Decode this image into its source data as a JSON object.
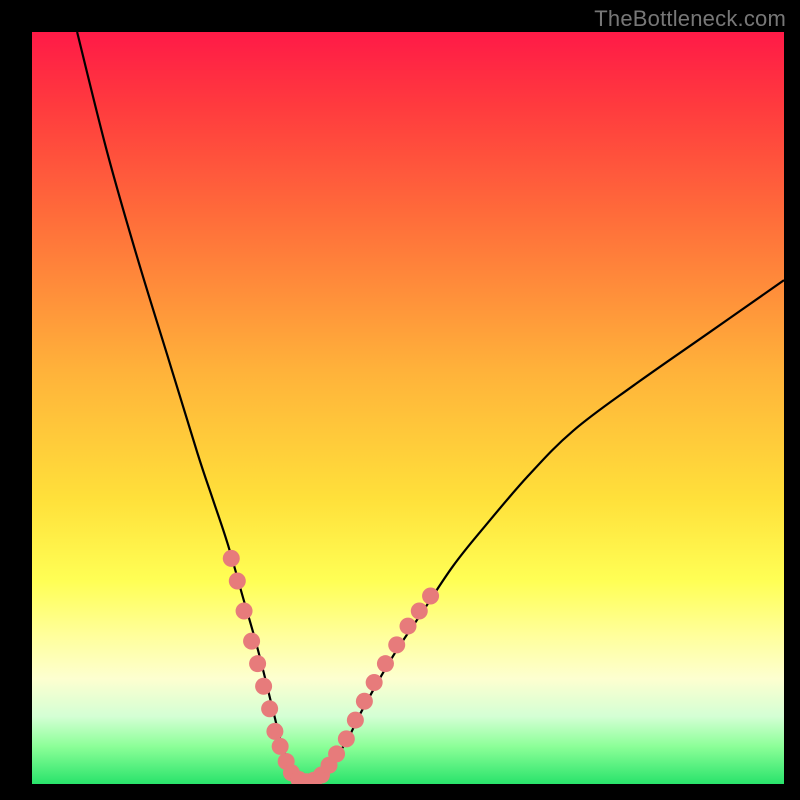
{
  "watermark": "TheBottleneck.com",
  "chart_data": {
    "type": "line",
    "title": "",
    "xlabel": "",
    "ylabel": "",
    "xlim": [
      0,
      100
    ],
    "ylim": [
      0,
      100
    ],
    "series": [
      {
        "name": "bottleneck-curve",
        "x": [
          6,
          10,
          14,
          18,
          22,
          24,
          26,
          28,
          30,
          32,
          33,
          34,
          35,
          36,
          37,
          38,
          40,
          42,
          44,
          48,
          52,
          56,
          60,
          66,
          72,
          80,
          90,
          100
        ],
        "values": [
          100,
          84,
          70,
          57,
          44,
          38,
          32,
          25,
          18,
          10,
          6,
          3,
          1,
          0,
          0,
          1,
          3,
          6,
          10,
          17,
          23,
          29,
          34,
          41,
          47,
          53,
          60,
          67
        ]
      }
    ],
    "markers": {
      "name": "highlight-dots",
      "color": "#e77b7b",
      "points": [
        {
          "x": 26.5,
          "y": 30
        },
        {
          "x": 27.3,
          "y": 27
        },
        {
          "x": 28.2,
          "y": 23
        },
        {
          "x": 29.2,
          "y": 19
        },
        {
          "x": 30.0,
          "y": 16
        },
        {
          "x": 30.8,
          "y": 13
        },
        {
          "x": 31.6,
          "y": 10
        },
        {
          "x": 32.3,
          "y": 7
        },
        {
          "x": 33.0,
          "y": 5
        },
        {
          "x": 33.8,
          "y": 3
        },
        {
          "x": 34.5,
          "y": 1.5
        },
        {
          "x": 35.5,
          "y": 0.6
        },
        {
          "x": 36.5,
          "y": 0.3
        },
        {
          "x": 37.5,
          "y": 0.5
        },
        {
          "x": 38.5,
          "y": 1.2
        },
        {
          "x": 39.5,
          "y": 2.5
        },
        {
          "x": 40.5,
          "y": 4
        },
        {
          "x": 41.8,
          "y": 6
        },
        {
          "x": 43.0,
          "y": 8.5
        },
        {
          "x": 44.2,
          "y": 11
        },
        {
          "x": 45.5,
          "y": 13.5
        },
        {
          "x": 47.0,
          "y": 16
        },
        {
          "x": 48.5,
          "y": 18.5
        },
        {
          "x": 50.0,
          "y": 21
        },
        {
          "x": 51.5,
          "y": 23
        },
        {
          "x": 53.0,
          "y": 25
        }
      ]
    }
  }
}
